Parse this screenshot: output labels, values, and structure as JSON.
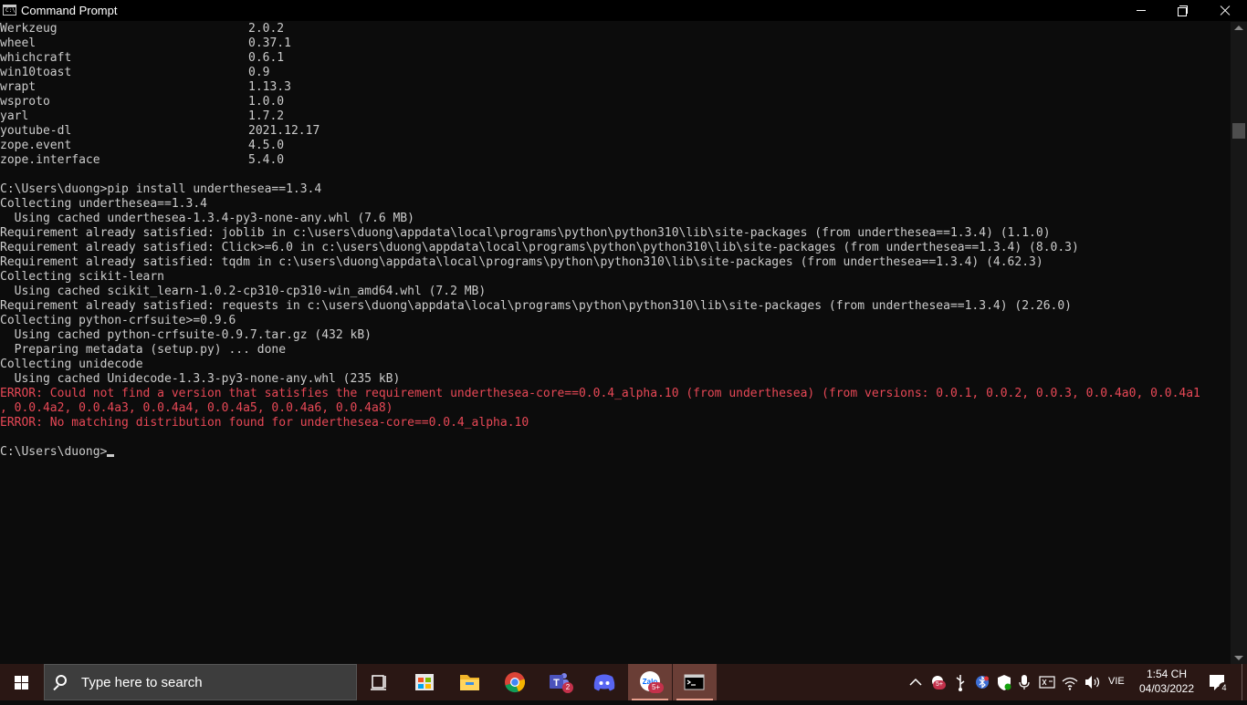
{
  "window": {
    "title": "Command Prompt",
    "icon_text": "C:\\"
  },
  "packages": [
    {
      "name": "Werkzeug",
      "version": "2.0.2"
    },
    {
      "name": "wheel",
      "version": "0.37.1"
    },
    {
      "name": "whichcraft",
      "version": "0.6.1"
    },
    {
      "name": "win10toast",
      "version": "0.9"
    },
    {
      "name": "wrapt",
      "version": "1.13.3"
    },
    {
      "name": "wsproto",
      "version": "1.0.0"
    },
    {
      "name": "yarl",
      "version": "1.7.2"
    },
    {
      "name": "youtube-dl",
      "version": "2021.12.17"
    },
    {
      "name": "zope.event",
      "version": "4.5.0"
    },
    {
      "name": "zope.interface",
      "version": "5.4.0"
    }
  ],
  "output": [
    "",
    "C:\\Users\\duong>pip install underthesea==1.3.4",
    "Collecting underthesea==1.3.4",
    "  Using cached underthesea-1.3.4-py3-none-any.whl (7.6 MB)",
    "Requirement already satisfied: joblib in c:\\users\\duong\\appdata\\local\\programs\\python\\python310\\lib\\site-packages (from underthesea==1.3.4) (1.1.0)",
    "Requirement already satisfied: Click>=6.0 in c:\\users\\duong\\appdata\\local\\programs\\python\\python310\\lib\\site-packages (from underthesea==1.3.4) (8.0.3)",
    "Requirement already satisfied: tqdm in c:\\users\\duong\\appdata\\local\\programs\\python\\python310\\lib\\site-packages (from underthesea==1.3.4) (4.62.3)",
    "Collecting scikit-learn",
    "  Using cached scikit_learn-1.0.2-cp310-cp310-win_amd64.whl (7.2 MB)",
    "Requirement already satisfied: requests in c:\\users\\duong\\appdata\\local\\programs\\python\\python310\\lib\\site-packages (from underthesea==1.3.4) (2.26.0)",
    "Collecting python-crfsuite>=0.9.6",
    "  Using cached python-crfsuite-0.9.7.tar.gz (432 kB)",
    "  Preparing metadata (setup.py) ... done",
    "Collecting unidecode",
    "  Using cached Unidecode-1.3.3-py3-none-any.whl (235 kB)"
  ],
  "errors": [
    "ERROR: Could not find a version that satisfies the requirement underthesea-core==0.0.4_alpha.10 (from underthesea) (from versions: 0.0.1, 0.0.2, 0.0.3, 0.0.4a0, 0.0.4a1",
    ", 0.0.4a2, 0.0.4a3, 0.0.4a4, 0.0.4a5, 0.0.4a6, 0.0.4a8)",
    "ERROR: No matching distribution found for underthesea-core==0.0.4_alpha.10"
  ],
  "prompt": "C:\\Users\\duong>",
  "colors": {
    "console_bg": "#0c0c0c",
    "console_text": "#cccccc",
    "error_text": "#e74856",
    "taskbar_bg": "#2a1714",
    "taskbar_active": "#6a3e36"
  },
  "taskbar": {
    "search_placeholder": "Type here to search",
    "apps": [
      {
        "icon": "task-view-icon"
      },
      {
        "icon": "microsoft-store-icon"
      },
      {
        "icon": "file-explorer-icon"
      },
      {
        "icon": "chrome-icon"
      },
      {
        "icon": "teams-icon",
        "badge": "2"
      },
      {
        "icon": "discord-icon"
      },
      {
        "icon": "zalo-icon",
        "badge": "5+"
      },
      {
        "icon": "command-prompt-icon"
      }
    ],
    "tray": {
      "language": "VIE",
      "time": "1:54 CH",
      "date": "04/03/2022",
      "notification_count": "4",
      "tray_badge": "5+"
    }
  }
}
